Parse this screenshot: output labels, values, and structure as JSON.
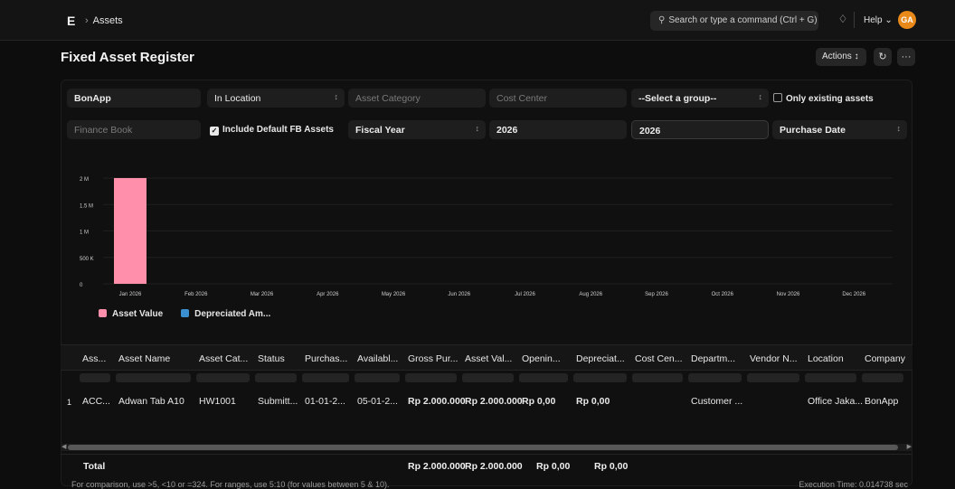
{
  "navbar": {
    "logo": "E",
    "breadcrumb": "Assets",
    "search_placeholder": "Search or type a command (Ctrl + G)",
    "help": "Help",
    "avatar_initials": "GA"
  },
  "page": {
    "title": "Fixed Asset Register",
    "actions_label": "Actions"
  },
  "filters": {
    "company": "BonApp",
    "status": "In Location",
    "asset_category": "Asset Category",
    "cost_center": "Cost Center",
    "group_by": "--Select a group--",
    "only_existing": "Only existing assets",
    "finance_book": "Finance Book",
    "include_default_fb": "Include Default FB Assets",
    "filter_based_on": "Fiscal Year",
    "from_fiscal_year": "2026",
    "to_fiscal_year": "2026",
    "date_based_on": "Purchase Date"
  },
  "chart_data": {
    "type": "bar",
    "categories": [
      "Jan 2026",
      "Feb 2026",
      "Mar 2026",
      "Apr 2026",
      "May 2026",
      "Jun 2026",
      "Jul 2026",
      "Aug 2026",
      "Sep 2026",
      "Oct 2026",
      "Nov 2026",
      "Dec 2026"
    ],
    "series": [
      {
        "name": "Asset Value",
        "values": [
          2000000,
          0,
          0,
          0,
          0,
          0,
          0,
          0,
          0,
          0,
          0,
          0
        ],
        "color": "#ff8fab"
      },
      {
        "name": "Depreciated Am...",
        "values": [
          0,
          0,
          0,
          0,
          0,
          0,
          0,
          0,
          0,
          0,
          0,
          0
        ],
        "color": "#3a8fd0"
      }
    ],
    "yticks": [
      "0",
      "500 K",
      "1 M",
      "1.5 M",
      "2 M"
    ],
    "ylim": [
      0,
      2000000
    ],
    "legend_position": "bottom-left"
  },
  "table": {
    "columns": [
      "Ass...",
      "Asset Name",
      "Asset Cat...",
      "Status",
      "Purchas...",
      "Availabl...",
      "Gross Pur...",
      "Asset Val...",
      "Openin...",
      "Depreciat...",
      "Cost Cen...",
      "Departm...",
      "Vendor N...",
      "Location",
      "Company"
    ],
    "rows": [
      {
        "index": "1",
        "cells": [
          "ACC...",
          "Adwan Tab A10",
          "HW1001",
          "Submitt...",
          "01-01-2...",
          "05-01-2...",
          "Rp 2.000.000",
          "Rp 2.000.000",
          "Rp 0,00",
          "Rp 0,00",
          "",
          "Customer ...",
          "",
          "Office Jaka...",
          "BonApp"
        ]
      }
    ],
    "totals": {
      "label": "Total",
      "gross": "Rp 2.000.000",
      "asset_value": "Rp 2.000.000",
      "opening": "Rp 0,00",
      "depreciated": "Rp 0,00"
    }
  },
  "footer": {
    "hint": "For comparison, use >5, <10 or =324. For ranges, use 5:10 (for values between 5 & 10).",
    "execution_time": "Execution Time: 0.014738 sec"
  }
}
